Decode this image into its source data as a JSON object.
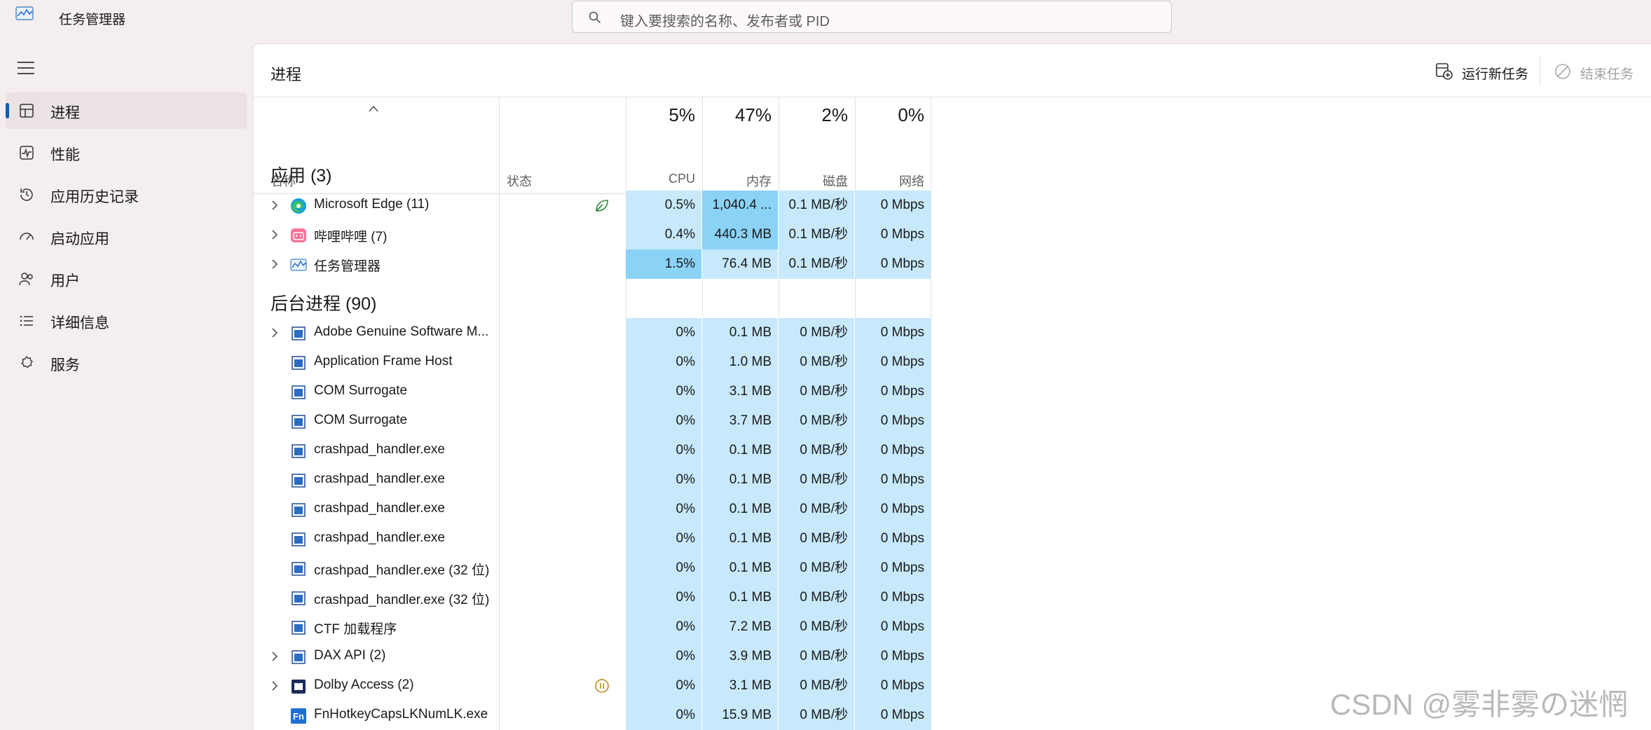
{
  "window": {
    "title": "任务管理器"
  },
  "search": {
    "placeholder": "键入要搜索的名称、发布者或 PID"
  },
  "sidebar": {
    "items": [
      {
        "label": "进程",
        "icon": "processes-icon",
        "active": true
      },
      {
        "label": "性能",
        "icon": "performance-icon"
      },
      {
        "label": "应用历史记录",
        "icon": "app-history-icon"
      },
      {
        "label": "启动应用",
        "icon": "startup-apps-icon"
      },
      {
        "label": "用户",
        "icon": "users-icon"
      },
      {
        "label": "详细信息",
        "icon": "details-icon"
      },
      {
        "label": "服务",
        "icon": "services-icon"
      }
    ]
  },
  "main": {
    "title": "进程",
    "run_task_label": "运行新任务",
    "end_task_label": "结束任务"
  },
  "table": {
    "columns": {
      "name": "名称",
      "status": "状态",
      "cpu": {
        "pct": "5%",
        "label": "CPU"
      },
      "memory": {
        "pct": "47%",
        "label": "内存"
      },
      "disk": {
        "pct": "2%",
        "label": "磁盘"
      },
      "network": {
        "pct": "0%",
        "label": "网络"
      }
    },
    "groups": [
      {
        "title": "应用 (3)",
        "rows": [
          {
            "name": "Microsoft Edge (11)",
            "icon": "edge-icon",
            "expandable": true,
            "status": "eco-leaf-icon",
            "cpu": "0.5%",
            "memory": "1,040.4 ...",
            "disk": "0.1 MB/秒",
            "network": "0 Mbps",
            "cpu_heat": 1,
            "mem_heat": 2
          },
          {
            "name": "哔哩哔哩 (7)",
            "icon": "bilibili-icon",
            "expandable": true,
            "cpu": "0.4%",
            "memory": "440.3 MB",
            "disk": "0.1 MB/秒",
            "network": "0 Mbps",
            "cpu_heat": 1,
            "mem_heat": 2
          },
          {
            "name": "任务管理器",
            "icon": "task-manager-icon",
            "expandable": true,
            "cpu": "1.5%",
            "memory": "76.4 MB",
            "disk": "0.1 MB/秒",
            "network": "0 Mbps",
            "cpu_heat": 2,
            "mem_heat": 1
          }
        ]
      },
      {
        "title": "后台进程 (90)",
        "rows": [
          {
            "name": "Adobe Genuine Software M...",
            "icon": "app-window-icon",
            "expandable": true,
            "cpu": "0%",
            "memory": "0.1 MB",
            "disk": "0 MB/秒",
            "network": "0 Mbps"
          },
          {
            "name": "Application Frame Host",
            "icon": "app-window-icon",
            "cpu": "0%",
            "memory": "1.0 MB",
            "disk": "0 MB/秒",
            "network": "0 Mbps"
          },
          {
            "name": "COM Surrogate",
            "icon": "app-window-icon",
            "cpu": "0%",
            "memory": "3.1 MB",
            "disk": "0 MB/秒",
            "network": "0 Mbps"
          },
          {
            "name": "COM Surrogate",
            "icon": "app-window-icon",
            "cpu": "0%",
            "memory": "3.7 MB",
            "disk": "0 MB/秒",
            "network": "0 Mbps"
          },
          {
            "name": "crashpad_handler.exe",
            "icon": "app-window-icon",
            "cpu": "0%",
            "memory": "0.1 MB",
            "disk": "0 MB/秒",
            "network": "0 Mbps"
          },
          {
            "name": "crashpad_handler.exe",
            "icon": "app-window-icon",
            "cpu": "0%",
            "memory": "0.1 MB",
            "disk": "0 MB/秒",
            "network": "0 Mbps"
          },
          {
            "name": "crashpad_handler.exe",
            "icon": "app-window-icon",
            "cpu": "0%",
            "memory": "0.1 MB",
            "disk": "0 MB/秒",
            "network": "0 Mbps"
          },
          {
            "name": "crashpad_handler.exe",
            "icon": "app-window-icon",
            "cpu": "0%",
            "memory": "0.1 MB",
            "disk": "0 MB/秒",
            "network": "0 Mbps"
          },
          {
            "name": "crashpad_handler.exe (32 位)",
            "icon": "app-window-icon",
            "cpu": "0%",
            "memory": "0.1 MB",
            "disk": "0 MB/秒",
            "network": "0 Mbps"
          },
          {
            "name": "crashpad_handler.exe (32 位)",
            "icon": "app-window-icon",
            "cpu": "0%",
            "memory": "0.1 MB",
            "disk": "0 MB/秒",
            "network": "0 Mbps"
          },
          {
            "name": "CTF 加载程序",
            "icon": "app-window-icon",
            "cpu": "0%",
            "memory": "7.2 MB",
            "disk": "0 MB/秒",
            "network": "0 Mbps"
          },
          {
            "name": "DAX API (2)",
            "icon": "app-window-icon",
            "expandable": true,
            "cpu": "0%",
            "memory": "3.9 MB",
            "disk": "0 MB/秒",
            "network": "0 Mbps"
          },
          {
            "name": "Dolby Access (2)",
            "icon": "dolby-icon",
            "expandable": true,
            "status": "paused-icon",
            "cpu": "0%",
            "memory": "3.1 MB",
            "disk": "0 MB/秒",
            "network": "0 Mbps"
          },
          {
            "name": "FnHotkeyCapsLKNumLK.exe",
            "icon": "fn-icon",
            "cpu": "0%",
            "memory": "15.9 MB",
            "disk": "0 MB/秒",
            "network": "0 Mbps"
          }
        ]
      }
    ]
  },
  "watermark": "CSDN @雾非雾の迷惘",
  "colors": {
    "accent": "#005fb8",
    "heat_low": "#c7e9fb",
    "heat_high": "#8bd2f7"
  }
}
